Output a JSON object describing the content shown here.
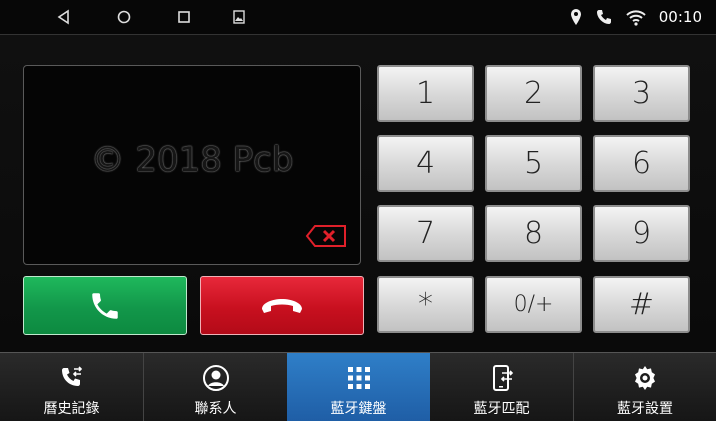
{
  "status_bar": {
    "nav_icons": [
      "back-icon",
      "home-icon",
      "recents-icon",
      "screenshot-icon"
    ],
    "status_icons": [
      "location-icon",
      "phone-icon",
      "wifi-icon"
    ],
    "clock": "00:10"
  },
  "display": {
    "watermark": "© 2018 Pcb",
    "backspace_icon": "backspace-icon",
    "backspace_color": "#e0202a"
  },
  "call_buttons": {
    "call_icon": "phone-icon",
    "call_color": "#17a350",
    "hangup_icon": "hang-up-icon",
    "hangup_color": "#d4141f"
  },
  "keypad": {
    "keys": [
      "1",
      "2",
      "3",
      "4",
      "5",
      "6",
      "7",
      "8",
      "9",
      "*",
      "0/+",
      "#"
    ]
  },
  "tabs": [
    {
      "label": "曆史記錄",
      "icon": "call-history-icon"
    },
    {
      "label": "聯系人",
      "icon": "contacts-icon"
    },
    {
      "label": "藍牙鍵盤",
      "icon": "dialpad-icon",
      "active": true
    },
    {
      "label": "藍牙匹配",
      "icon": "device-pair-icon"
    },
    {
      "label": "藍牙設置",
      "icon": "settings-icon"
    }
  ],
  "colors": {
    "active_tab": "#2a72bd"
  }
}
